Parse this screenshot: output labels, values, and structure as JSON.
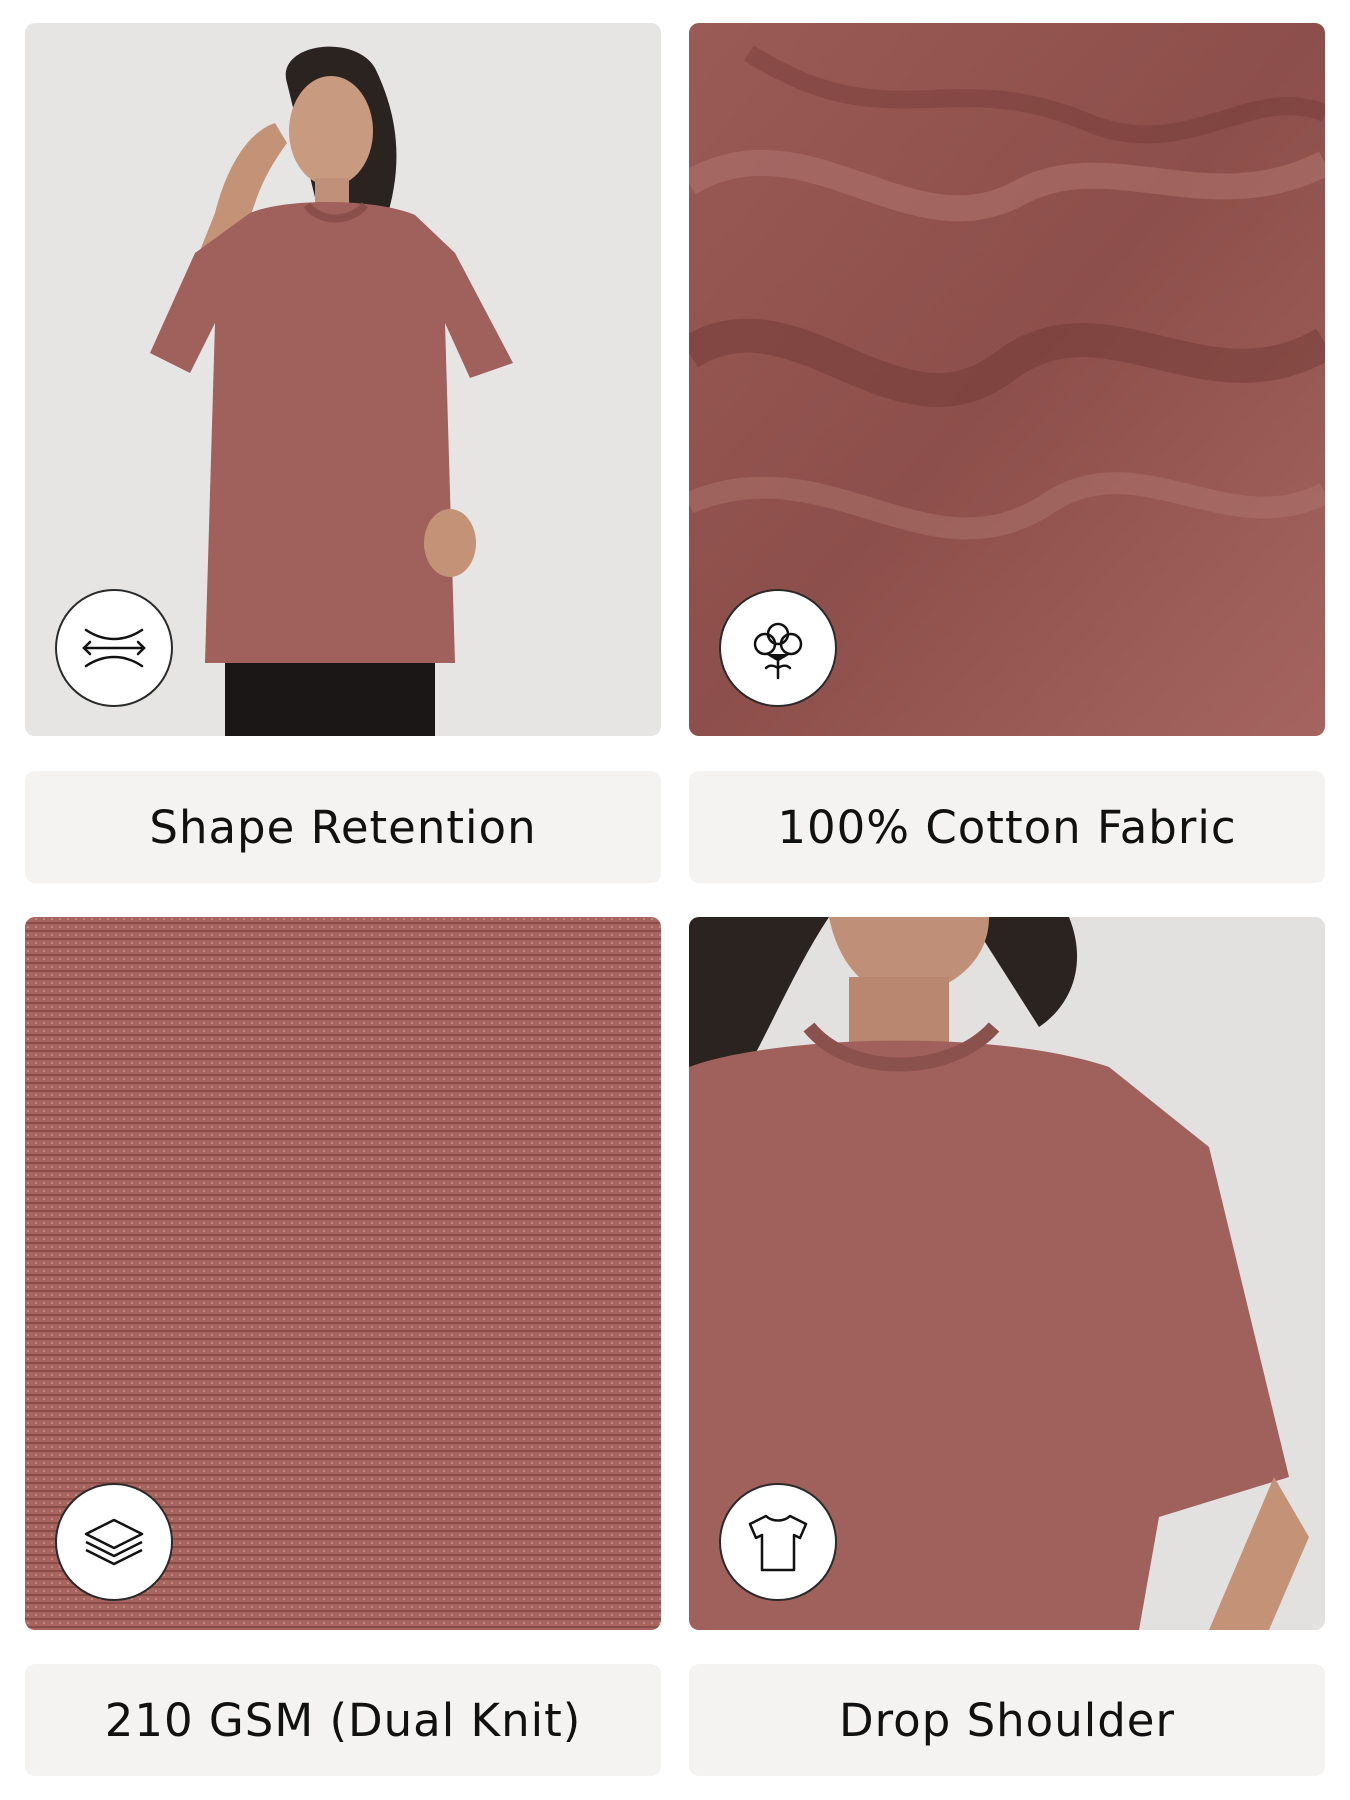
{
  "features": [
    {
      "caption": "Shape Retention",
      "icon": "stretch-arrows-icon"
    },
    {
      "caption": "100% Cotton Fabric",
      "icon": "cotton-flower-icon"
    },
    {
      "caption": "210 GSM (Dual Knit)",
      "icon": "layers-icon"
    },
    {
      "caption": "Drop Shoulder",
      "icon": "tshirt-icon"
    }
  ],
  "colors": {
    "fabric": "#a0605b",
    "fabric_dark": "#7c433f",
    "caption_bg": "#f4f3f1",
    "photo_bg": "#e9e8e6"
  }
}
